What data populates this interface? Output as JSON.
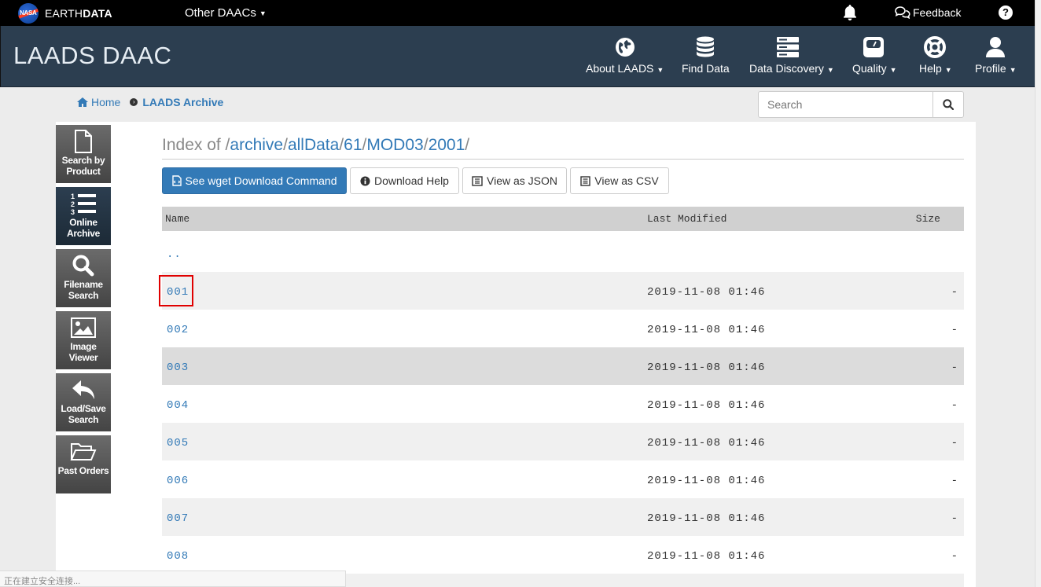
{
  "topbar": {
    "earth_prefix": "EARTH",
    "earth_suffix": "DATA",
    "nasa_text": "NASA",
    "other_daacs": "Other DAACs",
    "feedback": "Feedback"
  },
  "header": {
    "brand": "LAADS DAAC",
    "nav": [
      {
        "label": "About LAADS",
        "icon": "globe-icon",
        "dropdown": true
      },
      {
        "label": "Find Data",
        "icon": "database-icon",
        "dropdown": false
      },
      {
        "label": "Data Discovery",
        "icon": "server-icon",
        "dropdown": true
      },
      {
        "label": "Quality",
        "icon": "scale-icon",
        "dropdown": true
      },
      {
        "label": "Help",
        "icon": "lifebuoy-icon",
        "dropdown": true
      },
      {
        "label": "Profile",
        "icon": "user-icon",
        "dropdown": true
      }
    ]
  },
  "breadcrumb": {
    "home": "Home",
    "current": "LAADS Archive"
  },
  "search": {
    "placeholder": "Search"
  },
  "sidetools": [
    {
      "label1": "Search by",
      "label2": "Product",
      "icon": "file-icon"
    },
    {
      "label1": "Online",
      "label2": "Archive",
      "icon": "ordered-list-icon"
    },
    {
      "label1": "Filename",
      "label2": "Search",
      "icon": "search-icon"
    },
    {
      "label1": "Image",
      "label2": "Viewer",
      "icon": "image-icon"
    },
    {
      "label1": "Load/Save",
      "label2": "Search",
      "icon": "reply-icon"
    },
    {
      "label1": "Past Orders",
      "label2": "",
      "icon": "folder-open-icon"
    }
  ],
  "index": {
    "prefix": "Index of /",
    "parts": [
      "archive",
      "allData",
      "61",
      "MOD03",
      "2001"
    ],
    "sep": "/"
  },
  "buttons": {
    "wget": "See wget Download Command",
    "download_help": "Download Help",
    "json": "View as JSON",
    "csv": "View as CSV"
  },
  "table": {
    "columns": {
      "name": "Name",
      "modified": "Last Modified",
      "size": "Size"
    },
    "parent": "..",
    "rows": [
      {
        "name": "001",
        "modified": "2019-11-08 01:46",
        "size": "-"
      },
      {
        "name": "002",
        "modified": "2019-11-08 01:46",
        "size": "-"
      },
      {
        "name": "003",
        "modified": "2019-11-08 01:46",
        "size": "-"
      },
      {
        "name": "004",
        "modified": "2019-11-08 01:46",
        "size": "-"
      },
      {
        "name": "005",
        "modified": "2019-11-08 01:46",
        "size": "-"
      },
      {
        "name": "006",
        "modified": "2019-11-08 01:46",
        "size": "-"
      },
      {
        "name": "007",
        "modified": "2019-11-08 01:46",
        "size": "-"
      },
      {
        "name": "008",
        "modified": "2019-11-08 01:46",
        "size": "-"
      }
    ]
  },
  "status": "正在建立安全连接..."
}
